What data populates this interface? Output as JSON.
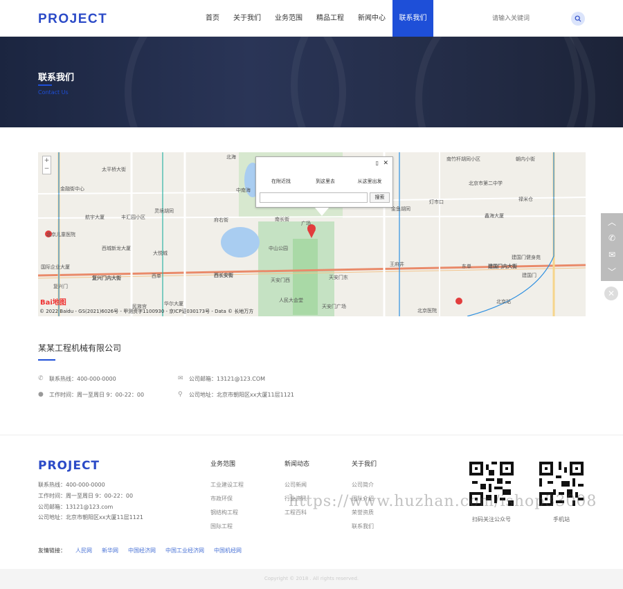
{
  "header": {
    "logo": "PROJECT",
    "nav": [
      "首页",
      "关于我们",
      "业务范围",
      "精品工程",
      "新闻中心",
      "联系我们"
    ],
    "search_placeholder": "请输入关键词"
  },
  "banner": {
    "title": "联系我们",
    "subtitle": "Contact Us"
  },
  "map": {
    "popup_tabs": [
      "在附近找",
      "到这里去",
      "从这里出发"
    ],
    "popup_search": "搜索",
    "copyright": "© 2022 Baidu - GS(2021)6026号 - 甲测资字1100930 - 京ICP证030173号 - Data © 长地万方",
    "baidu": "Bai地图",
    "labels": [
      "金融街中心",
      "北京儿童医院",
      "西城新龙大厦",
      "复兴门内大街",
      "西长安街",
      "中山公园",
      "天安门西",
      "天安门东",
      "人民大会堂",
      "天安门广场",
      "王府井",
      "东单",
      "建国门内大街",
      "北京站",
      "北京医院",
      "北京市第二中学",
      "禄米仓",
      "灯市口",
      "金鱼胡同",
      "国际企业大厦",
      "府右街",
      "南长街",
      "航宇大厦",
      "丰汇园小区",
      "灵境胡同",
      "大悦城",
      "西单",
      "华尔大厦",
      "建国门",
      "中南海",
      "北海",
      "南竹杆胡同小区",
      "朝内小街",
      "鑫海大厦",
      "建国门健身苑",
      "复兴门",
      "广场",
      "民族宫",
      "太平桥大街"
    ]
  },
  "contact": {
    "company": "某某工程机械有限公司",
    "phone": "联系热线：400-000-0000",
    "hours": "工作时间：周一至周日 9：00-22：00",
    "email": "公司邮箱：13121@123.COM",
    "address": "公司地址：北京市朝阳区xx大厦11层1121"
  },
  "footer": {
    "logo": "PROJECT",
    "phone": "联系热线：400-000-0000",
    "hours": "工作时间：周一至周日 9：00-22：00",
    "email": "公司邮箱：13121@123.com",
    "address": "公司地址：北京市朝阳区xx大厦11层1121",
    "col1": {
      "title": "业务范围",
      "links": [
        "工业建设工程",
        "市政环保",
        "钢结构工程",
        "国际工程"
      ]
    },
    "col2": {
      "title": "新闻动态",
      "links": [
        "公司新闻",
        "行业资讯",
        "工程百科"
      ]
    },
    "col3": {
      "title": "关于我们",
      "links": [
        "公司简介",
        "团队介绍",
        "荣誉资质",
        "联系我们"
      ]
    },
    "qr1": "扫码关注公众号",
    "qr2": "手机站",
    "friend_label": "友情链接：",
    "friends": [
      "人民网",
      "新华网",
      "中国经济网",
      "中国工业经济网",
      "中国机经网"
    ],
    "copyright": "Copyright © 2018 . All rights reserved.",
    "watermark": "https://www.huzhan.com/ishop33008"
  },
  "colors": {
    "brand": "#1e4fd8",
    "banner": "#242d48"
  }
}
